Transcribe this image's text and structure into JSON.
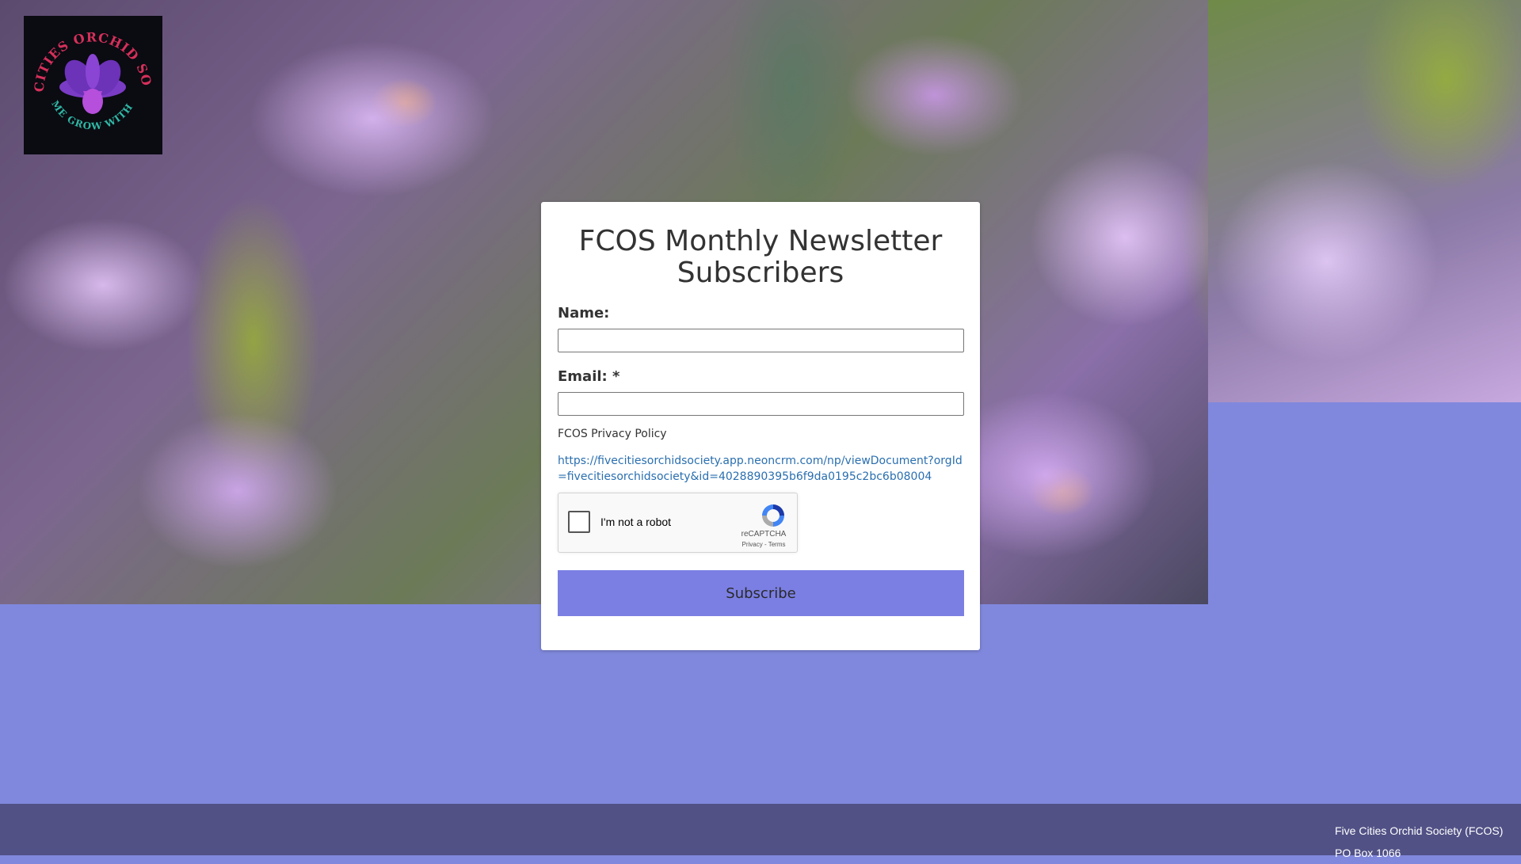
{
  "logo": {
    "top_text": "FIVE CITIES ORCHID SOCIETY",
    "bottom_text": "COME GROW WITH US"
  },
  "form": {
    "title": "FCOS Monthly Newsletter Subscribers",
    "name_label": "Name:",
    "email_label": "Email: *",
    "policy_label": "FCOS Privacy Policy",
    "policy_link": "https://fivecitiesorchidsociety.app.neoncrm.com/np/viewDocument?orgId=fivecitiesorchidsociety&id=4028890395b6f9da0195c2bc6b08004",
    "subscribe_label": "Subscribe"
  },
  "recaptcha": {
    "checkbox_label": "I'm not a robot",
    "brand": "reCAPTCHA",
    "terms": "Privacy - Terms"
  },
  "footer": {
    "line1": "Five Cities Orchid Society (FCOS)",
    "line2": "PO Box 1066"
  },
  "colors": {
    "page_background": "#8088dd",
    "subscribe_button": "#7b7fe3",
    "footer": "#515186",
    "link": "#2a6fb0"
  }
}
